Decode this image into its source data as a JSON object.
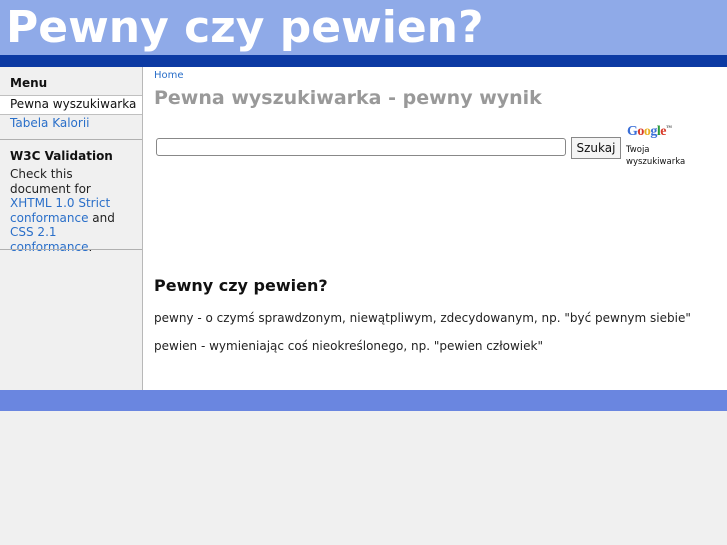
{
  "header": {
    "site_title": "Pewny czy pewien?"
  },
  "sidebar": {
    "menu_heading": "Menu",
    "menu_items": [
      {
        "label": "Pewna wyszukiwarka",
        "active": true
      },
      {
        "label": "Tabela Kalorii",
        "active": false
      }
    ],
    "w3c_heading": "W3C Validation",
    "w3c_text_1": "Check this document for ",
    "w3c_link_xhtml": "XHTML 1.0 Strict conformance",
    "w3c_text_2": " and ",
    "w3c_link_css": "CSS 2.1 conformance",
    "w3c_text_3": "."
  },
  "main": {
    "breadcrumb": "Home",
    "page_title": "Pewna wyszukiwarka - pewny wynik",
    "search": {
      "value": "",
      "button_label": "Szukaj"
    },
    "google": {
      "letters": [
        "G",
        "o",
        "o",
        "g",
        "l",
        "e"
      ],
      "trademark": "™",
      "caption": "Twoja wyszukiwarka"
    },
    "section_heading": "Pewny czy pewien?",
    "definitions": [
      "pewny - o czymś sprawdzonym, niewątpliwym, zdecydowanym, np. \"być pewnym siebie\"",
      "pewien - wymieniając coś nieokreślonego, np. \"pewien człowiek\""
    ]
  },
  "colors": {
    "header_bg": "#8faae8",
    "header_bar": "#0c3aa3",
    "footer_bar": "#6a86e0",
    "link": "#2a6fc9",
    "title_gray": "#999999",
    "google_letters": [
      "#3a6fd8",
      "#d83a2a",
      "#e8b020",
      "#3a6fd8",
      "#2a9a3a",
      "#d83a2a"
    ]
  }
}
